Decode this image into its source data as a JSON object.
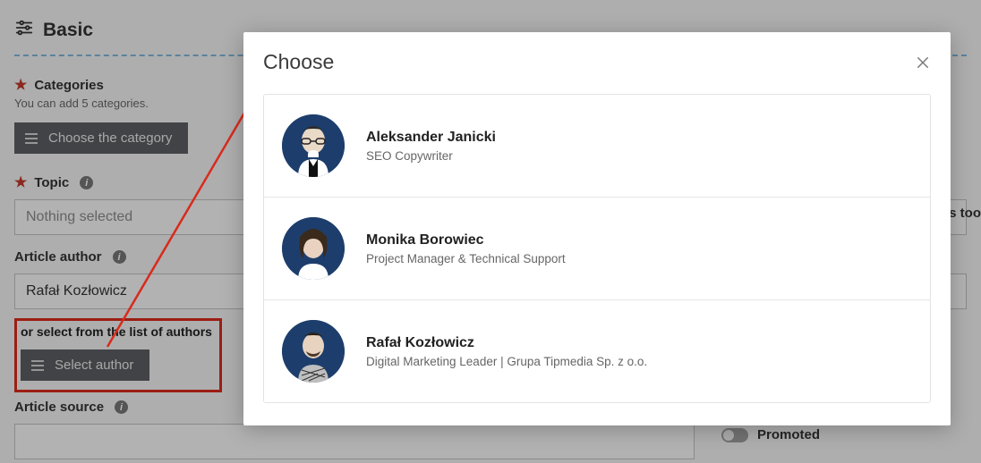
{
  "section": {
    "title": "Basic"
  },
  "categories": {
    "label": "Categories",
    "help": "You can add 5 categories.",
    "button": "Choose the category"
  },
  "topic": {
    "label": "Topic",
    "placeholder": "Nothing selected"
  },
  "author": {
    "label": "Article author",
    "value": "Rafał Kozłowicz",
    "alt_label": "or select from the list of authors",
    "select_button": "Select author"
  },
  "source": {
    "label": "Article source"
  },
  "overflow_hint": "is too",
  "promoted": {
    "label": "Promoted"
  },
  "modal": {
    "title": "Choose",
    "authors": [
      {
        "name": "Aleksander Janicki",
        "role": "SEO Copywriter"
      },
      {
        "name": "Monika Borowiec",
        "role": "Project Manager & Technical Support"
      },
      {
        "name": "Rafał Kozłowicz",
        "role": "Digital Marketing Leader | Grupa Tipmedia Sp. z o.o."
      }
    ]
  }
}
